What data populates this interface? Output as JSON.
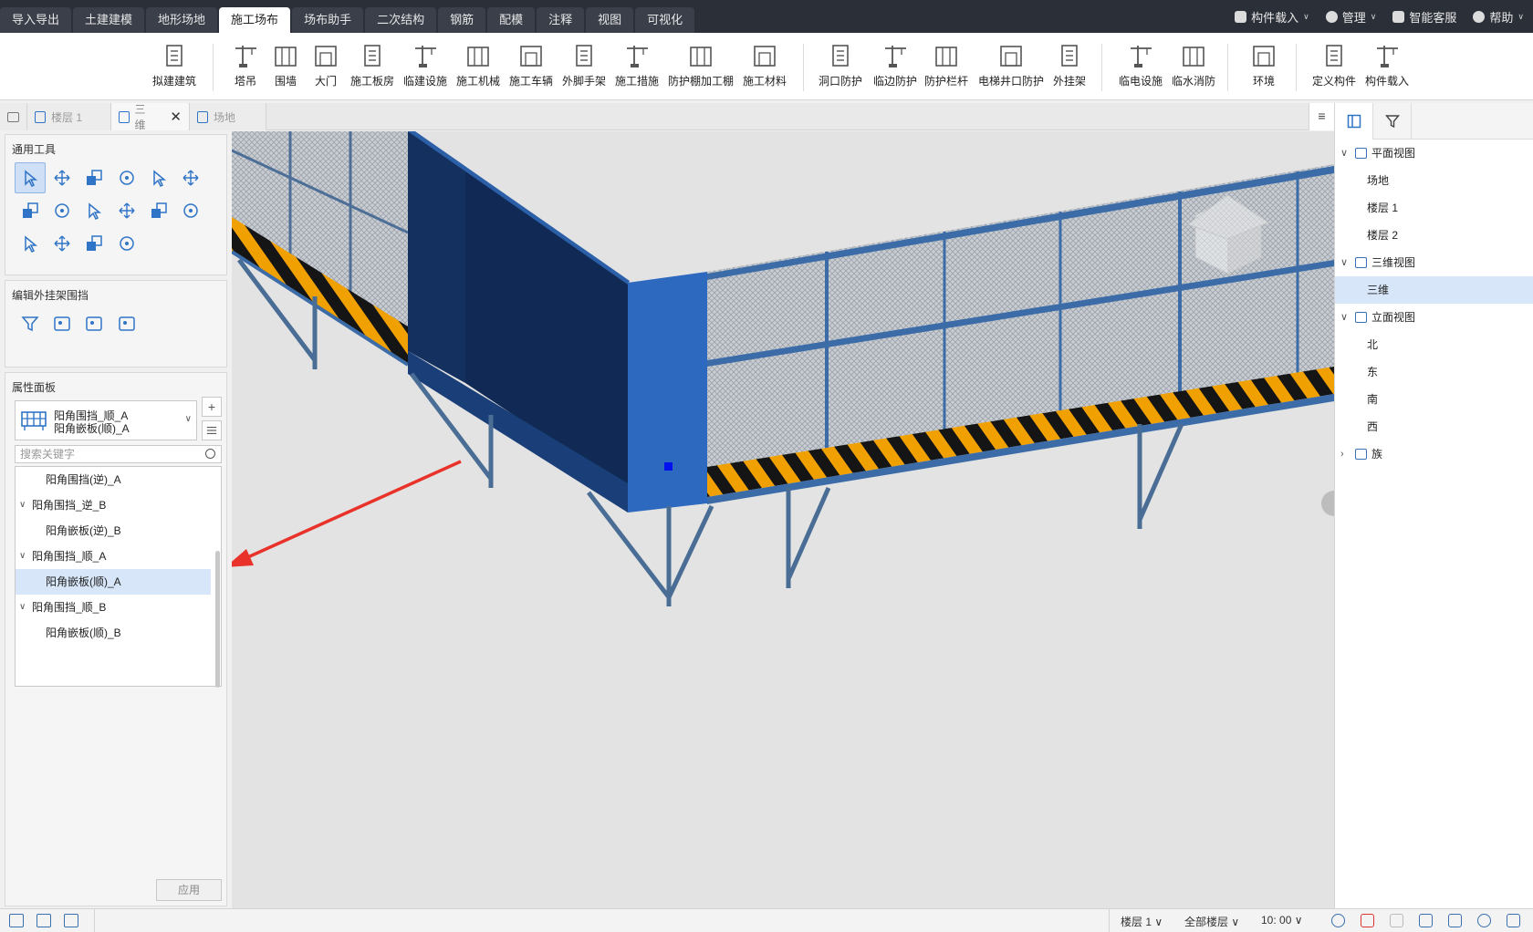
{
  "top_tabs": [
    "导入导出",
    "土建建模",
    "地形场地",
    "施工场布",
    "场布助手",
    "二次结构",
    "钢筋",
    "配模",
    "注释",
    "视图",
    "可视化"
  ],
  "top_right": {
    "load": "构件载入",
    "manage": "管理",
    "service": "智能客服",
    "help": "帮助"
  },
  "ribbon": {
    "groups": [
      [
        "拟建建筑"
      ],
      [
        "塔吊",
        "围墙",
        "大门",
        "施工板房",
        "临建设施",
        "施工机械",
        "施工车辆",
        "外脚手架",
        "施工措施",
        "防护棚加工棚",
        "施工材料"
      ],
      [
        "洞口防护",
        "临边防护",
        "防护栏杆",
        "电梯井口防护",
        "外挂架"
      ],
      [
        "临电设施",
        "临水消防"
      ],
      [
        "环境"
      ],
      [
        "定义构件",
        "构件载入"
      ]
    ]
  },
  "doc_tabs": {
    "floor1": "楼层 1",
    "threed": "三维",
    "site": "场地",
    "menu": "≡"
  },
  "tools_panel": {
    "title": "通用工具"
  },
  "edit_panel": {
    "title": "编辑外挂架围挡"
  },
  "props_panel": {
    "title": "属性面板",
    "type_line1": "阳角围挡_顺_A",
    "type_line2": "阳角嵌板(顺)_A",
    "search_placeholder": "搜索关键字",
    "tree": [
      {
        "label": "阳角围挡(逆)_A",
        "level": 1,
        "expand": false
      },
      {
        "label": "阳角围挡_逆_B",
        "level": 0,
        "expand": true
      },
      {
        "label": "阳角嵌板(逆)_B",
        "level": 1,
        "expand": false
      },
      {
        "label": "阳角围挡_顺_A",
        "level": 0,
        "expand": true
      },
      {
        "label": "阳角嵌板(顺)_A",
        "level": 1,
        "expand": false,
        "selected": true
      },
      {
        "label": "阳角围挡_顺_B",
        "level": 0,
        "expand": true
      },
      {
        "label": "阳角嵌板(顺)_B",
        "level": 1,
        "expand": false
      }
    ],
    "apply": "应用"
  },
  "view_tree": [
    {
      "label": "平面视图",
      "level": 0,
      "exp": "v"
    },
    {
      "label": "场地",
      "level": 1
    },
    {
      "label": "楼层 1",
      "level": 1
    },
    {
      "label": "楼层 2",
      "level": 1
    },
    {
      "label": "三维视图",
      "level": 0,
      "exp": "v"
    },
    {
      "label": "三维",
      "level": 1,
      "selected": true
    },
    {
      "label": "立面视图",
      "level": 0,
      "exp": "v"
    },
    {
      "label": "北",
      "level": 1
    },
    {
      "label": "东",
      "level": 1
    },
    {
      "label": "南",
      "level": 1
    },
    {
      "label": "西",
      "level": 1
    },
    {
      "label": "族",
      "level": 0,
      "exp": ">"
    }
  ],
  "status_bar": {
    "floor": "楼层 1",
    "all_floors": "全部楼层",
    "time": "10: 00"
  },
  "colors": {
    "accent": "#2f74c6",
    "dark_bar": "#2b2f38",
    "panel_blue": "#1f5fb0",
    "hazard_orange": "#f0a000",
    "arrow_red": "#e8322a"
  }
}
